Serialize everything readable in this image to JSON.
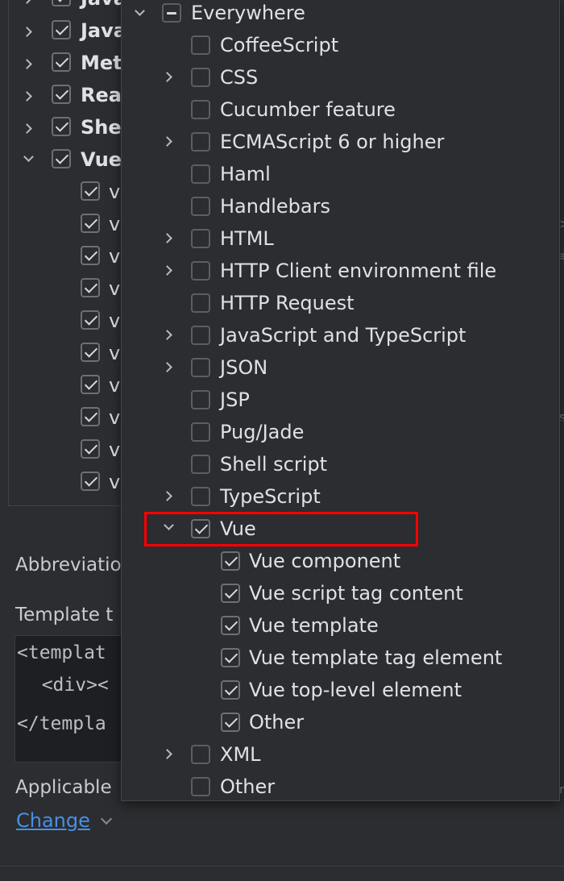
{
  "background": {
    "tree_items": [
      {
        "label": "Java"
      },
      {
        "label": "Java"
      },
      {
        "label": "Met"
      },
      {
        "label": "Rea"
      },
      {
        "label": "She"
      },
      {
        "label": "Vue"
      }
    ],
    "vue_children": [
      "v",
      "v",
      "v",
      "v",
      "v",
      "v",
      "v",
      "v",
      "v",
      "v"
    ],
    "abbreviation_label": "Abbreviatio",
    "template_label": "Template t",
    "code_lines": [
      "<templat",
      "  <div><",
      "</templa"
    ],
    "applicable_label": "Applicable",
    "change_link": "Change"
  },
  "popup": {
    "everywhere_label": "Everywhere",
    "items": [
      {
        "label": "CoffeeScript",
        "expandable": false
      },
      {
        "label": "CSS",
        "expandable": true
      },
      {
        "label": "Cucumber feature",
        "expandable": false
      },
      {
        "label": "ECMAScript 6 or higher",
        "expandable": true
      },
      {
        "label": "Haml",
        "expandable": false
      },
      {
        "label": "Handlebars",
        "expandable": false
      },
      {
        "label": "HTML",
        "expandable": true
      },
      {
        "label": "HTTP Client environment file",
        "expandable": true
      },
      {
        "label": "HTTP Request",
        "expandable": false
      },
      {
        "label": "JavaScript and TypeScript",
        "expandable": true
      },
      {
        "label": "JSON",
        "expandable": true
      },
      {
        "label": "JSP",
        "expandable": false
      },
      {
        "label": "Pug/Jade",
        "expandable": false
      },
      {
        "label": "Shell script",
        "expandable": false
      },
      {
        "label": "TypeScript",
        "expandable": true
      },
      {
        "label": "Vue",
        "expandable": true,
        "expanded": true,
        "checked": true
      },
      {
        "label": "XML",
        "expandable": true
      },
      {
        "label": "Other",
        "expandable": false
      }
    ],
    "vue_children": [
      {
        "label": "Vue component"
      },
      {
        "label": "Vue script tag content"
      },
      {
        "label": "Vue template"
      },
      {
        "label": "Vue template tag element"
      },
      {
        "label": "Vue top-level element"
      },
      {
        "label": "Other"
      }
    ]
  },
  "colors": {
    "background": "#2b2d30",
    "highlight": "#ff0000",
    "link": "#4a8fe3"
  }
}
